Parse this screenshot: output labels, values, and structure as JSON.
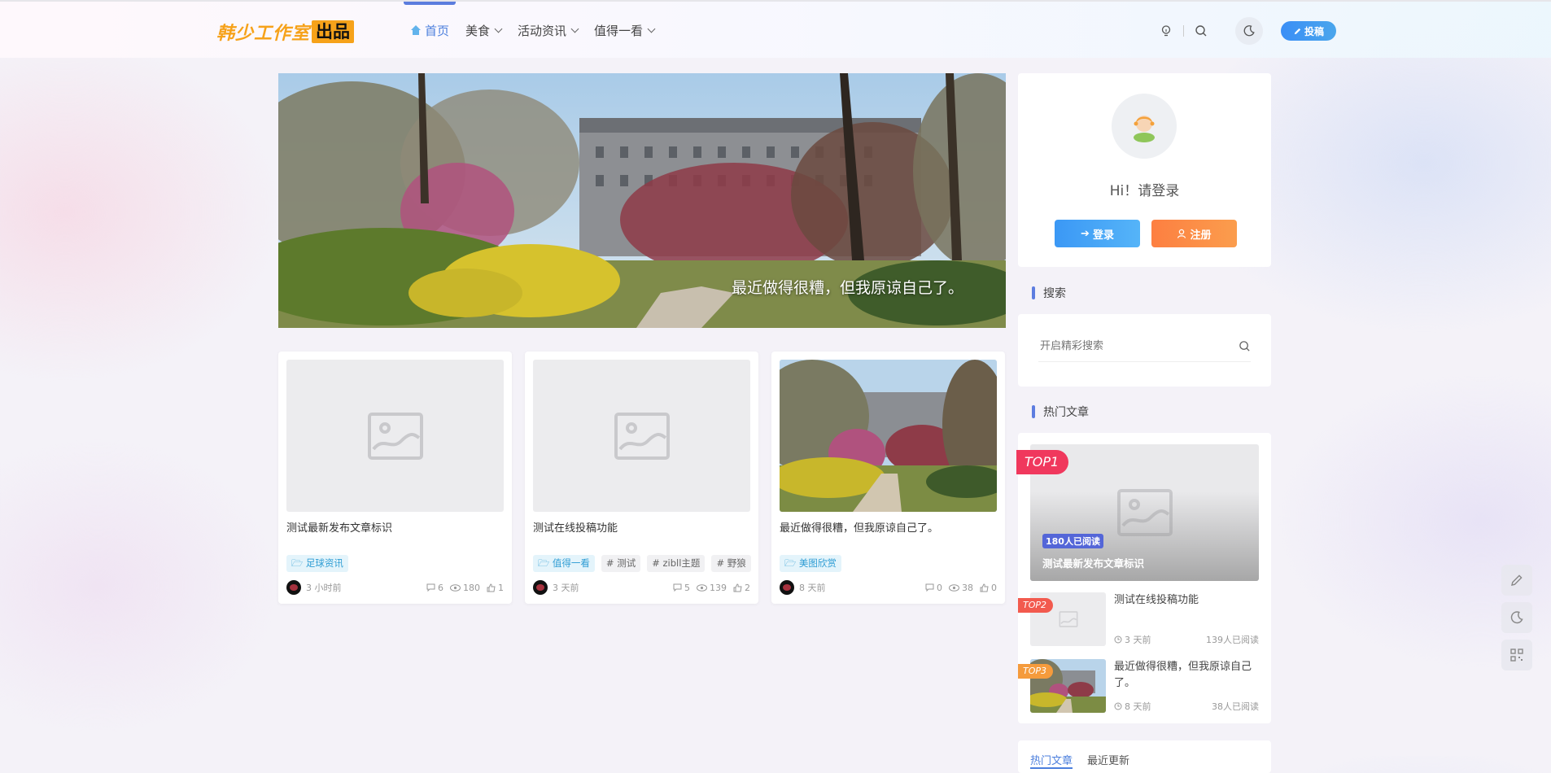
{
  "header": {
    "logo_text": "韩少工作室",
    "logo_tag": "出品",
    "nav": [
      {
        "label": "首页"
      },
      {
        "label": "美食"
      },
      {
        "label": "活动资讯"
      },
      {
        "label": "值得一看"
      }
    ],
    "submit_label": "投稿"
  },
  "slider": {
    "caption": "最近做得很糟，但我原谅自己了。"
  },
  "posts": [
    {
      "title": "测试最新发布文章标识",
      "category": "足球资讯",
      "tags": [],
      "time": "3 小时前",
      "comments": "6",
      "views": "180",
      "likes": "1"
    },
    {
      "title": "测试在线投稿功能",
      "category": "值得一看",
      "tags": [
        "# 测试",
        "# zibll主题",
        "# 野狼"
      ],
      "time": "3 天前",
      "comments": "5",
      "views": "139",
      "likes": "2"
    },
    {
      "title": "最近做得很糟，但我原谅自己了。",
      "category": "美图欣赏",
      "tags": [],
      "time": "8 天前",
      "comments": "0",
      "views": "38",
      "likes": "0"
    }
  ],
  "sidebar": {
    "greeting": "Hi！请登录",
    "login_label": "登录",
    "register_label": "注册",
    "search_title": "搜索",
    "search_placeholder": "开启精彩搜索",
    "hot_title": "热门文章",
    "hot": [
      {
        "rank": "TOP1",
        "title": "测试最新发布文章标识",
        "reads": "180人已阅读"
      },
      {
        "rank": "TOP2",
        "title": "测试在线投稿功能",
        "date": "3 天前",
        "reads": "139人已阅读"
      },
      {
        "rank": "TOP3",
        "title": "最近做得很糟，但我原谅自己了。",
        "date": "8 天前",
        "reads": "38人已阅读"
      }
    ],
    "next_tabs": [
      "热门文章",
      "最近更新"
    ]
  },
  "colors": {
    "accent": "#5b7dde",
    "logo": "#f6a21a",
    "login": "#3b98f5",
    "register": "#fd7f41"
  }
}
